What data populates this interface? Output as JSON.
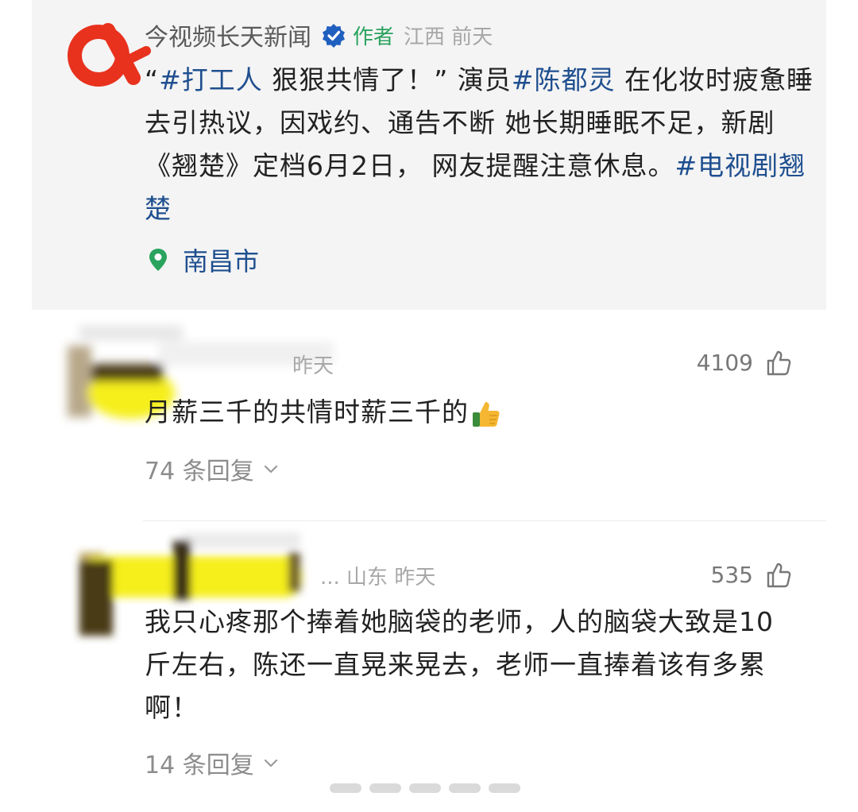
{
  "post": {
    "author_name": "今视频长天新闻",
    "author_tag": "作者",
    "author_meta": "江西 前天",
    "text": {
      "quote_open": "“",
      "hashtag1": "#打工人",
      "seg1": " 狠狠共情了！” 演员",
      "hashtag2": "#陈都灵",
      "seg2": " 在化妆时疲惫睡去引热议，因戏约、通告不断 她长期睡眠不足，新剧《翘楚》定档6月2日， 网友提醒注意休息。",
      "hashtag3": "#电视剧翘楚"
    },
    "location": "南昌市"
  },
  "comments": [
    {
      "meta": "昨天",
      "likes": "4109",
      "text": "月薪三千的共情时薪三千的",
      "replies": "74 条回复"
    },
    {
      "meta": "... 山东 昨天",
      "likes": "535",
      "text": "我只心疼那个捧着她脑袋的老师，人的脑袋大致是10斤左右，陈还一直晃来晃去，老师一直捧着该有多累啊！",
      "replies": "14 条回复"
    }
  ],
  "colors": {
    "link": "#1f4f8f",
    "verified": "#1f5fbf",
    "author_tag": "#2aa35e",
    "logo": "#e8321e",
    "censor_yellow": "#f6ef1f"
  }
}
